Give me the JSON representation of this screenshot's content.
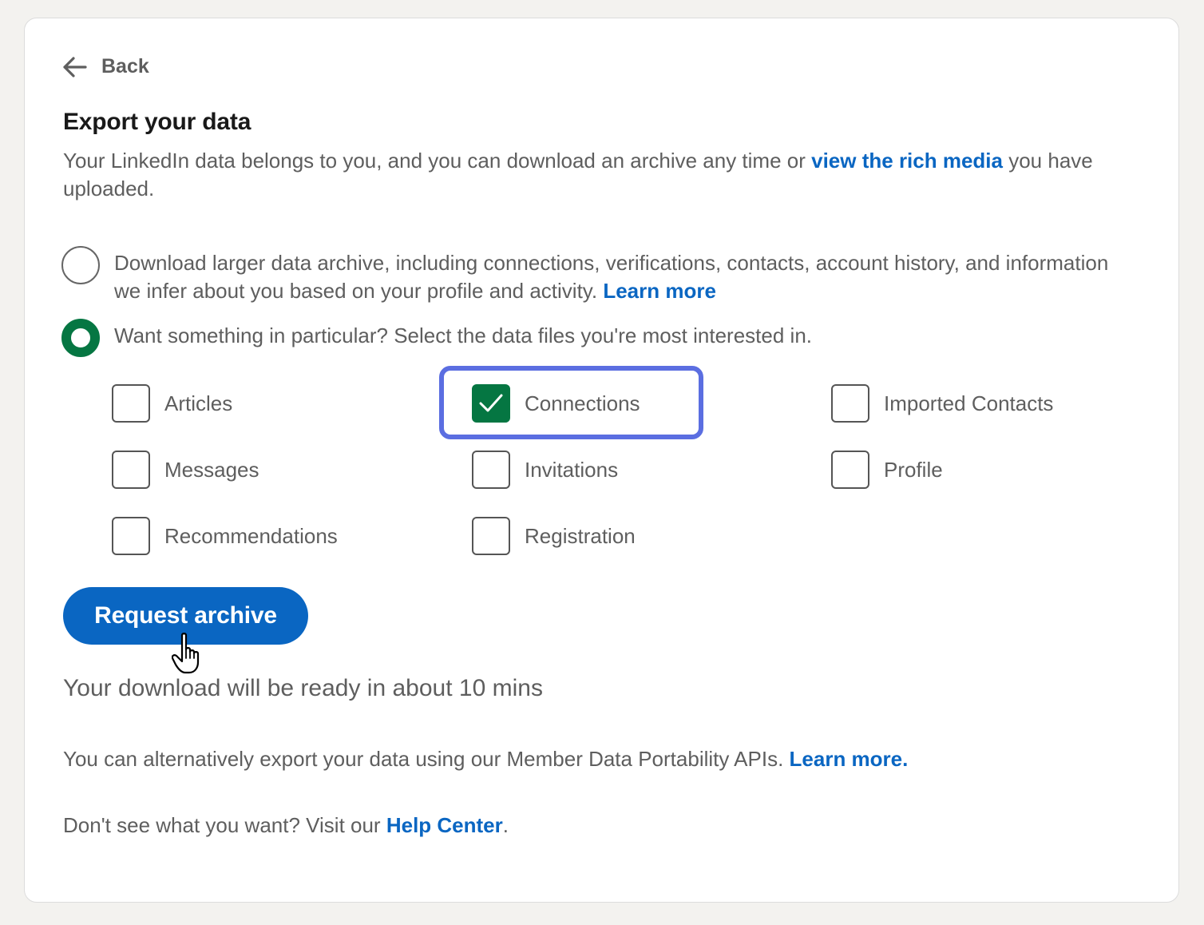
{
  "nav": {
    "back_label": "Back"
  },
  "page": {
    "title": "Export your data",
    "description_prefix": "Your LinkedIn data belongs to you, and you can download an archive any time or ",
    "description_link": "view the rich media",
    "description_suffix": " you have uploaded."
  },
  "options": {
    "larger_archive": {
      "text": "Download larger data archive, including connections, verifications, contacts, account history, and information we infer about you based on your profile and activity. ",
      "link": "Learn more",
      "selected": false
    },
    "particular": {
      "text": "Want something in particular? Select the data files you're most interested in.",
      "selected": true
    }
  },
  "data_files": [
    {
      "label": "Articles",
      "checked": false
    },
    {
      "label": "Connections",
      "checked": true
    },
    {
      "label": "Imported Contacts",
      "checked": false
    },
    {
      "label": "Messages",
      "checked": false
    },
    {
      "label": "Invitations",
      "checked": false
    },
    {
      "label": "Profile",
      "checked": false
    },
    {
      "label": "Recommendations",
      "checked": false
    },
    {
      "label": "Registration",
      "checked": false
    }
  ],
  "actions": {
    "request_label": "Request archive"
  },
  "status": {
    "ready_text": "Your download will be ready in about 10 mins"
  },
  "footer": {
    "alt_text": "You can alternatively export your data using our Member Data Portability APIs. ",
    "alt_link": "Learn more.",
    "help_prefix": "Don't see what you want? Visit our ",
    "help_link": "Help Center",
    "help_suffix": "."
  },
  "colors": {
    "accent_blue": "#0a66c2",
    "check_green": "#057642",
    "focus_ring": "#5b6ee1"
  },
  "icons": {
    "back": "arrow-left-icon",
    "check": "checkmark-icon",
    "cursor": "hand-pointer-icon"
  }
}
